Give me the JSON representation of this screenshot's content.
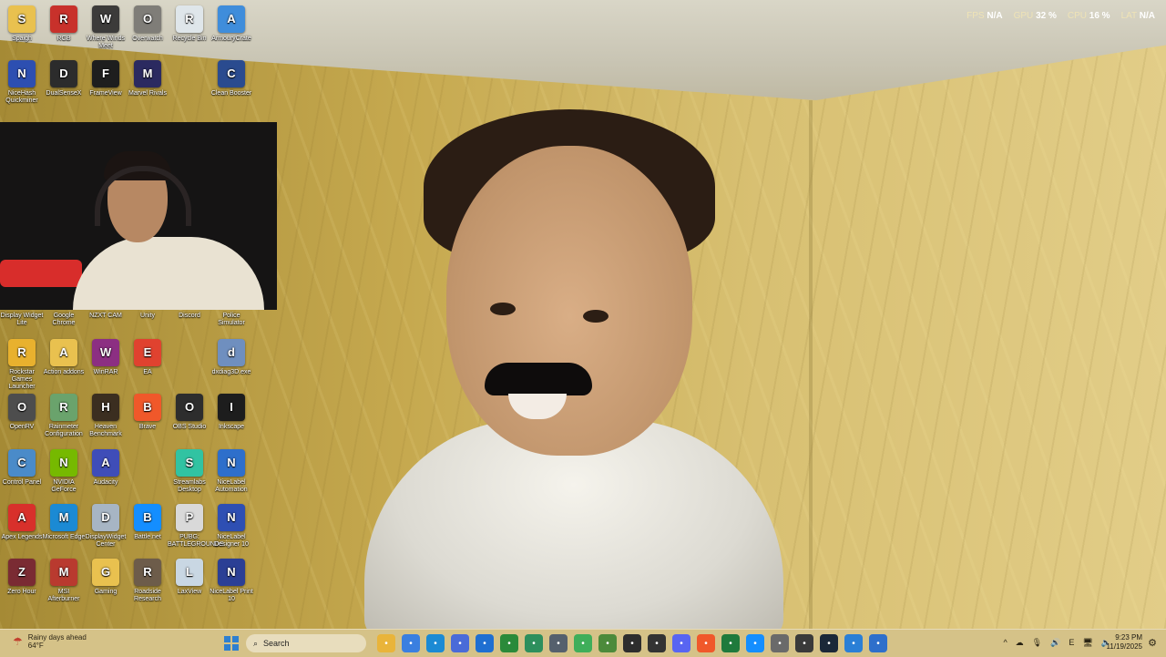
{
  "hud": {
    "fps_label": "FPS",
    "fps_value": "N/A",
    "gpu_label": "GPU",
    "gpu_value": "32 %",
    "cpu_label": "CPU",
    "cpu_value": "16 %",
    "lat_label": "LAT",
    "lat_value": "N/A"
  },
  "desktop_icons": [
    {
      "label": "Spaigh",
      "icon": "folder-icon",
      "color": "#e9c14f"
    },
    {
      "label": "RGB",
      "icon": "razer-icon",
      "color": "#c8312b"
    },
    {
      "label": "Where Winds Meet",
      "icon": "game-icon",
      "color": "#3c3b3a"
    },
    {
      "label": "Overwatch",
      "icon": "overwatch-icon",
      "color": "#7f7d78"
    },
    {
      "label": "Recycle Bin",
      "icon": "recycle-bin-icon",
      "color": "#dfe6ea"
    },
    {
      "label": "ArmouryCrate",
      "icon": "armoury-icon",
      "color": "#3f8ddb"
    },
    {
      "label": "NiceHash Quickminer",
      "icon": "nicehash-icon",
      "color": "#2d4fb1"
    },
    {
      "label": "DualSenseX",
      "icon": "dualsense-icon",
      "color": "#2c2c2c"
    },
    {
      "label": "FrameView",
      "icon": "frameview-icon",
      "color": "#1e1e1e"
    },
    {
      "label": "Marvel Rivals",
      "icon": "marvel-rivals-icon",
      "color": "#2b2a60"
    },
    {
      "label": "Clean Booster",
      "icon": "clean-booster-icon",
      "color": "#2a4b8f"
    },
    {
      "label": "Display Widget Lite",
      "icon": "widget-icon",
      "color": "#55606d"
    },
    {
      "label": "Google Chrome",
      "icon": "chrome-icon",
      "color": "#d9452b"
    },
    {
      "label": "NZXT CAM",
      "icon": "nzxt-icon",
      "color": "#5b5b5b"
    },
    {
      "label": "Unity",
      "icon": "unity-icon",
      "color": "#444444"
    },
    {
      "label": "Discord",
      "icon": "discord-icon",
      "color": "#5865f2"
    },
    {
      "label": "Police Simulator",
      "icon": "police-icon",
      "color": "#384f8c"
    },
    {
      "label": "Rockstar Games Launcher",
      "icon": "rockstar-icon",
      "color": "#e8b12e"
    },
    {
      "label": "Action addons",
      "icon": "folder-icon",
      "color": "#e9c14f"
    },
    {
      "label": "WinRAR",
      "icon": "winrar-icon",
      "color": "#8c2f82"
    },
    {
      "label": "EA",
      "icon": "ea-icon",
      "color": "#e0422f"
    },
    {
      "label": "dxdiag3D.exe",
      "icon": "dxdiag-icon",
      "color": "#6f8fbf"
    },
    {
      "label": "OpenRV",
      "icon": "openrv-icon",
      "color": "#4d4d4d"
    },
    {
      "label": "Rainmeter Configuration",
      "icon": "rainmeter-icon",
      "color": "#6aa36c"
    },
    {
      "label": "Heaven Benchmark",
      "icon": "heaven-icon",
      "color": "#3b2e20"
    },
    {
      "label": "Brave",
      "icon": "brave-icon",
      "color": "#f0582a"
    },
    {
      "label": "OBS Studio",
      "icon": "obs-icon",
      "color": "#2d2d2d"
    },
    {
      "label": "Inkscape",
      "icon": "inkscape-icon",
      "color": "#1d1d1d"
    },
    {
      "label": "Control Panel",
      "icon": "control-panel-icon",
      "color": "#4a8bc9"
    },
    {
      "label": "NVIDIA GeForce",
      "icon": "nvidia-icon",
      "color": "#76b900"
    },
    {
      "label": "Audacity",
      "icon": "audacity-icon",
      "color": "#3f4db8"
    },
    {
      "label": "Streamlabs Desktop",
      "icon": "streamlabs-icon",
      "color": "#31c3a2"
    },
    {
      "label": "NiceLabel Automation",
      "icon": "nicelabel-icon",
      "color": "#2e6fcb"
    },
    {
      "label": "Apex Legends",
      "icon": "apex-icon",
      "color": "#d8302b"
    },
    {
      "label": "Microsoft Edge",
      "icon": "edge-icon",
      "color": "#1b8ad4"
    },
    {
      "label": "DisplayWidget Center",
      "icon": "display-icon",
      "color": "#a7b5c4"
    },
    {
      "label": "Battle.net",
      "icon": "battlenet-icon",
      "color": "#148eff"
    },
    {
      "label": "PUBG: BATTLEGROUNDS",
      "icon": "pubg-icon",
      "color": "#d9d9d9"
    },
    {
      "label": "NiceLabel Designer 10",
      "icon": "nicelabel-designer-icon",
      "color": "#2e4fb3"
    },
    {
      "label": "Zero Hour",
      "icon": "zero-hour-icon",
      "color": "#7a2b33"
    },
    {
      "label": "MSI Afterburner",
      "icon": "msi-icon",
      "color": "#b93a2f"
    },
    {
      "label": "Gaming",
      "icon": "folder-icon",
      "color": "#e9c14f"
    },
    {
      "label": "Roadside Research",
      "icon": "roadside-icon",
      "color": "#6d5c4a"
    },
    {
      "label": "LaxView",
      "icon": "laxview-icon",
      "color": "#c9d7e3"
    },
    {
      "label": "NiceLabel Print 10",
      "icon": "nicelabel-print-icon",
      "color": "#2b3f95"
    }
  ],
  "taskbar": {
    "weather_title": "Rainy days ahead",
    "weather_temp": "64°F",
    "search_placeholder": "Search",
    "apps": [
      {
        "name": "file-explorer-icon",
        "color": "#e9b43a"
      },
      {
        "name": "copilot-icon",
        "color": "#3a7fe0"
      },
      {
        "name": "edge-icon",
        "color": "#1b8ad4"
      },
      {
        "name": "store-icon",
        "color": "#4a6bd8"
      },
      {
        "name": "outlook-icon",
        "color": "#1f6fd1"
      },
      {
        "name": "xbox-icon",
        "color": "#2a8a3a"
      },
      {
        "name": "chart-icon",
        "color": "#2d8f5d"
      },
      {
        "name": "monitor-icon",
        "color": "#55606d"
      },
      {
        "name": "play-icon",
        "color": "#3fae5a"
      },
      {
        "name": "android-icon",
        "color": "#4c8a3b"
      },
      {
        "name": "obs-icon",
        "color": "#2d2d2d"
      },
      {
        "name": "github-icon",
        "color": "#333333"
      },
      {
        "name": "discord-icon",
        "color": "#5865f2"
      },
      {
        "name": "brave-icon",
        "color": "#f0582a"
      },
      {
        "name": "xbox-app-icon",
        "color": "#1f7a3c"
      },
      {
        "name": "battlenet-icon",
        "color": "#148eff"
      },
      {
        "name": "settings-icon",
        "color": "#6a6a6a"
      },
      {
        "name": "terminal-icon",
        "color": "#3a3a3a"
      },
      {
        "name": "steam-icon",
        "color": "#1b2838"
      },
      {
        "name": "chat-icon",
        "color": "#2a7fd6"
      },
      {
        "name": "paint-icon",
        "color": "#2e6fcb"
      }
    ],
    "tray": [
      "^",
      "☁",
      "🎙",
      "🔊",
      "E",
      "🖥",
      "🔈"
    ],
    "time": "9:23 PM",
    "date": "11/19/2025"
  }
}
